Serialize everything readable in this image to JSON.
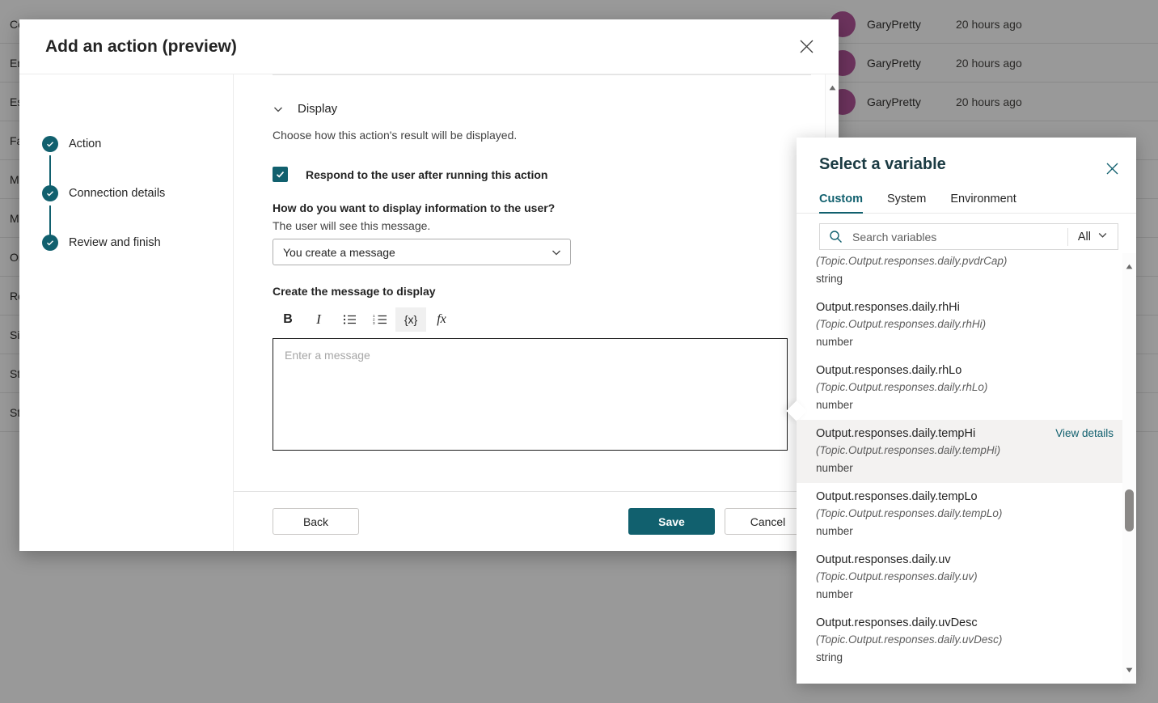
{
  "background": {
    "rows": [
      {
        "name": "Con",
        "author": "GaryPretty",
        "time": "20 hours ago"
      },
      {
        "name": "End",
        "author": "GaryPretty",
        "time": "20 hours ago"
      },
      {
        "name": "Esc",
        "author": "GaryPretty",
        "time": "20 hours ago"
      },
      {
        "name": "Fall",
        "author": "",
        "time": ""
      },
      {
        "name": "MS",
        "author": "",
        "time": ""
      },
      {
        "name": "Mu",
        "author": "",
        "time": ""
      },
      {
        "name": "On",
        "author": "",
        "time": ""
      },
      {
        "name": "Res",
        "author": "",
        "time": ""
      },
      {
        "name": "Sig",
        "author": "",
        "time": ""
      },
      {
        "name": "Sto",
        "author": "",
        "time": ""
      },
      {
        "name": "Sto",
        "author": "",
        "time": ""
      }
    ]
  },
  "dialog": {
    "title": "Add an action (preview)",
    "close_icon": "close-icon",
    "wizard": {
      "steps": [
        {
          "label": "Action",
          "state": "completed"
        },
        {
          "label": "Connection details",
          "state": "completed"
        },
        {
          "label": "Review and finish",
          "state": "completed"
        }
      ]
    },
    "section": {
      "chevron_icon": "chevron-down-icon",
      "title": "Display",
      "description": "Choose how this action's result will be displayed."
    },
    "respond_checkbox": {
      "label": "Respond to the user after running this action",
      "checked": true
    },
    "display_question": "How do you want to display information to the user?",
    "display_subtext": "The user will see this message.",
    "display_select": {
      "value": "You create a message",
      "chevron_icon": "chevron-down-icon"
    },
    "editor": {
      "label": "Create the message to display",
      "toolbar": [
        {
          "name": "bold-icon",
          "glyph": "B",
          "active": false
        },
        {
          "name": "italic-icon",
          "glyph": "I",
          "active": false
        },
        {
          "name": "bulleted-list-icon",
          "glyph": "",
          "active": false
        },
        {
          "name": "numbered-list-icon",
          "glyph": "",
          "active": false
        },
        {
          "name": "insert-variable-icon",
          "glyph": "{x}",
          "active": true
        },
        {
          "name": "formula-icon",
          "glyph": "fx",
          "active": false
        }
      ],
      "placeholder": "Enter a message",
      "value": ""
    },
    "footer": {
      "back_label": "Back",
      "save_label": "Save",
      "cancel_label": "Cancel"
    },
    "scroll_up_icon": "scroll-up-arrow-icon",
    "scroll_down_icon": "scroll-down-arrow-icon"
  },
  "flyout": {
    "title": "Select a variable",
    "close_icon": "close-icon",
    "tabs": [
      {
        "label": "Custom",
        "selected": true
      },
      {
        "label": "System",
        "selected": false
      },
      {
        "label": "Environment",
        "selected": false
      }
    ],
    "search": {
      "icon": "search-icon",
      "placeholder": "Search variables",
      "value": ""
    },
    "filter": {
      "label": "All",
      "chevron_icon": "chevron-down-icon"
    },
    "view_details_label": "View details",
    "variables": [
      {
        "name": "",
        "path": "(Topic.Output.responses.daily.pvdrCap)",
        "type": "string",
        "hovered": false,
        "partial": true,
        "show_details": false
      },
      {
        "name": "Output.responses.daily.rhHi",
        "path": "(Topic.Output.responses.daily.rhHi)",
        "type": "number",
        "hovered": false,
        "partial": false,
        "show_details": false
      },
      {
        "name": "Output.responses.daily.rhLo",
        "path": "(Topic.Output.responses.daily.rhLo)",
        "type": "number",
        "hovered": false,
        "partial": false,
        "show_details": false
      },
      {
        "name": "Output.responses.daily.tempHi",
        "path": "(Topic.Output.responses.daily.tempHi)",
        "type": "number",
        "hovered": true,
        "partial": false,
        "show_details": true
      },
      {
        "name": "Output.responses.daily.tempLo",
        "path": "(Topic.Output.responses.daily.tempLo)",
        "type": "number",
        "hovered": false,
        "partial": false,
        "show_details": false
      },
      {
        "name": "Output.responses.daily.uv",
        "path": "(Topic.Output.responses.daily.uv)",
        "type": "number",
        "hovered": false,
        "partial": false,
        "show_details": false
      },
      {
        "name": "Output.responses.daily.uvDesc",
        "path": "(Topic.Output.responses.daily.uvDesc)",
        "type": "string",
        "hovered": false,
        "partial": false,
        "show_details": false
      }
    ],
    "scroll_up_icon": "scroll-up-arrow-icon",
    "scroll_down_icon": "scroll-down-arrow-icon"
  },
  "colors": {
    "accent": "#11606e",
    "avatar": "#b4559c",
    "hover_row": "#f3f2f1"
  }
}
